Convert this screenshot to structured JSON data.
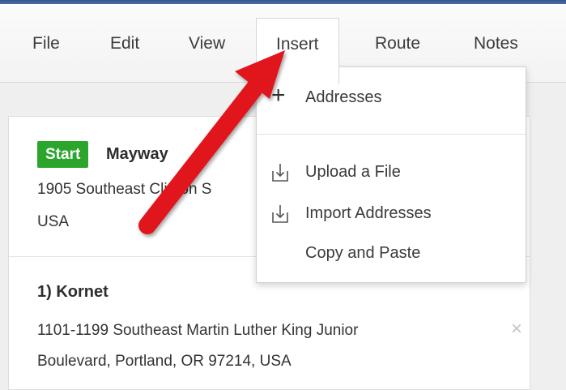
{
  "menu": {
    "file": "File",
    "edit": "Edit",
    "view": "View",
    "insert": "Insert",
    "route": "Route",
    "notes": "Notes"
  },
  "insert_menu": {
    "addresses": "Addresses",
    "upload_file": "Upload a File",
    "import_addresses": "Import Addresses",
    "copy_paste": "Copy and Paste"
  },
  "start": {
    "badge": "Start",
    "name": "Mayway",
    "address_line1": "1905 Southeast Clinton S",
    "address_line2": "USA"
  },
  "stops": [
    {
      "title": "1) Kornet",
      "address_line1": "1101-1199 Southeast Martin Luther King Junior",
      "address_line2": "Boulevard, Portland, OR 97214, USA",
      "remove": "×"
    }
  ],
  "colors": {
    "start_badge": "#2ca52c",
    "annotation_arrow": "#e0161b",
    "title_strip": "#34558f"
  },
  "icons": {
    "addresses": "plus-icon",
    "upload": "upload-tray-icon",
    "import": "import-tray-icon",
    "remove": "close-icon"
  }
}
